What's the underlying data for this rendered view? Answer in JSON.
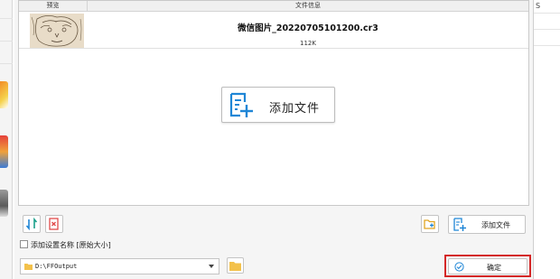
{
  "list": {
    "header": {
      "preview": "预览",
      "file_info": "文件信息"
    },
    "files": [
      {
        "name": "微信图片_20220705101200.cr3",
        "size": "112K"
      }
    ]
  },
  "actions": {
    "big_add_label": "添加文件",
    "toolbar_add_label": "添加文件",
    "confirm_label": "确定"
  },
  "settings": {
    "add_setting_name_label": "添加设置名称 [原始大小]",
    "add_setting_name_checked": false
  },
  "output": {
    "path": "D:\\FFOutput"
  },
  "background": {
    "right_fragment": "S"
  },
  "icons": {
    "sort": "sort-icon",
    "remove": "remove-file-icon",
    "add_folder": "add-folder-icon",
    "add_file": "add-file-icon",
    "folder": "folder-icon",
    "confirm": "check-circle-icon",
    "dropdown": "chevron-down-icon"
  },
  "colors": {
    "accent": "#1f86d6",
    "highlight": "#d42727",
    "danger": "#e04a4a",
    "folder": "#f3c14b"
  }
}
